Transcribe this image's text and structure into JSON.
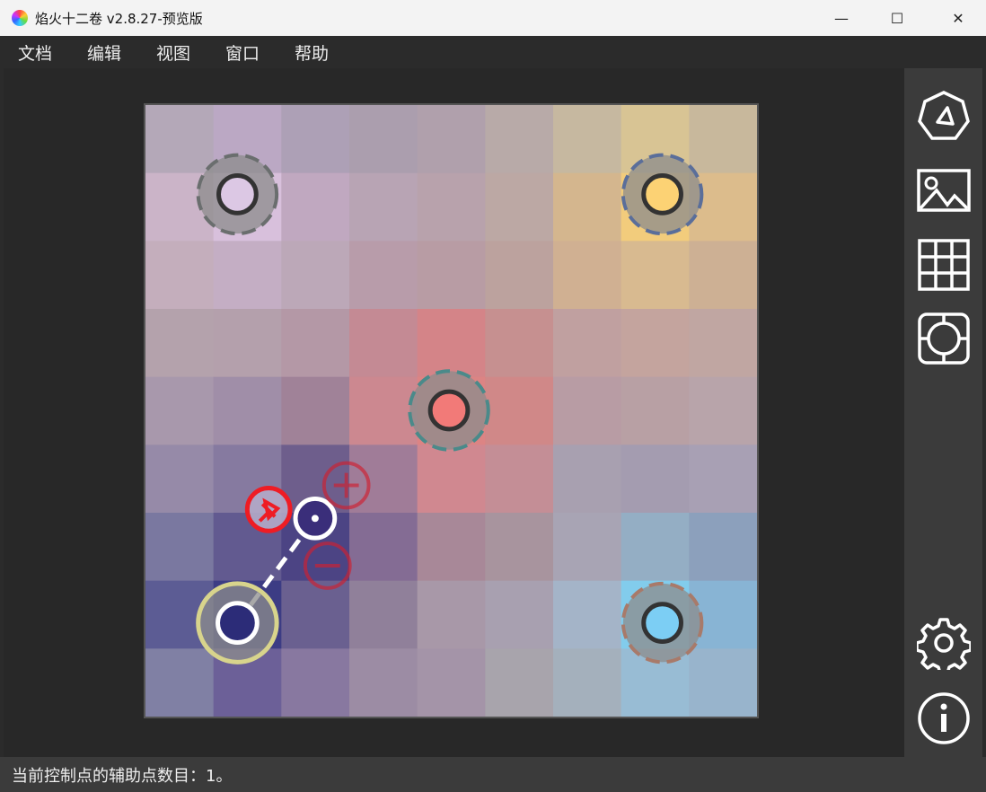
{
  "window": {
    "title": "焰火十二卷 v2.8.27-预览版",
    "minimize": "—",
    "maximize": "☐",
    "close": "✕"
  },
  "menu": [
    "文档",
    "编辑",
    "视图",
    "窗口",
    "帮助"
  ],
  "status": "当前控制点的辅助点数目：1。",
  "grid": [
    [
      "#b4a8b8",
      "#bba8c4",
      "#ada0b6",
      "#ab9eae",
      "#b0a0ac",
      "#b8aaa8",
      "#c6b8a0",
      "#d8c494",
      "#c8b89c"
    ],
    [
      "#cbb4c8",
      "#d8c0dc",
      "#c0a8c0",
      "#b8a4b4",
      "#b8a2ac",
      "#bca8a4",
      "#d4b68e",
      "#f2cc7c",
      "#dcbc8c"
    ],
    [
      "#c4aebc",
      "#c4aec4",
      "#bca8b8",
      "#b89caa",
      "#b89ca4",
      "#bca29e",
      "#d0b092",
      "#d8ba90",
      "#cdb094"
    ],
    [
      "#b4a2ac",
      "#b4a0ac",
      "#b498a6",
      "#c48a94",
      "#d48488",
      "#c69090",
      "#c0a0a0",
      "#c4a49e",
      "#c0a6a2"
    ],
    [
      "#a898ac",
      "#a08ea8",
      "#a08298",
      "#cc8890",
      "#dc8484",
      "#d08888",
      "#b89ca4",
      "#b8a0a4",
      "#b8a4aa"
    ],
    [
      "#968aa8",
      "#867aa0",
      "#6e5e8c",
      "#a07c98",
      "#d08890",
      "#c48e96",
      "#a8a0b0",
      "#a49cb0",
      "#a8a0b4"
    ],
    [
      "#7a78a0",
      "#625a90",
      "#4c4484",
      "#846c94",
      "#a88898",
      "#a8949e",
      "#a8a4b4",
      "#94aec4",
      "#8ca0bc"
    ],
    [
      "#5c5c94",
      "#3c3c84",
      "#6a6090",
      "#90809a",
      "#a898a8",
      "#a8a0b0",
      "#a4b4c8",
      "#82ccec",
      "#88b4d4"
    ],
    [
      "#8080a4",
      "#6c6098",
      "#8878a0",
      "#9c8ca4",
      "#a494a8",
      "#a8a4ac",
      "#a4b0bc",
      "#98bcd4",
      "#98b4cc"
    ]
  ],
  "control_points": [
    {
      "color": "#dcc8e4",
      "ring": "#6a6e6e"
    },
    {
      "color": "#fcd274",
      "ring": "#5a6e9a"
    },
    {
      "color": "#f27a78",
      "ring": "#4a8a8a"
    },
    {
      "color": "#2c2c78",
      "ring": "#d8d48c",
      "selected": true
    },
    {
      "color": "#7ccef4",
      "ring": "#a87a6a"
    }
  ],
  "accent": "#ee1c24"
}
